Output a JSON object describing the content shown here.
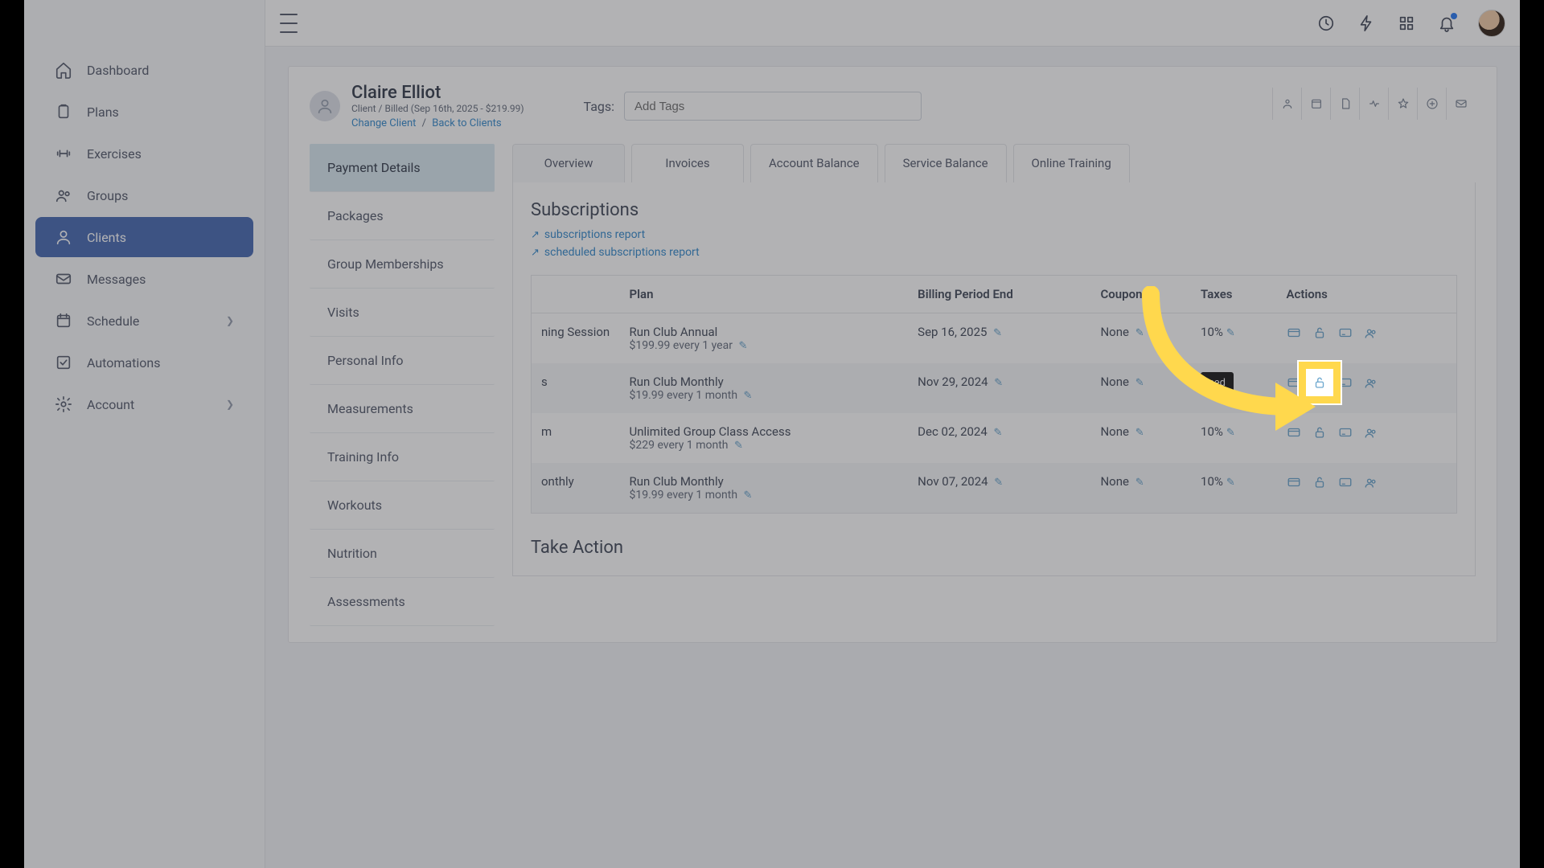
{
  "sidebar": {
    "items": [
      {
        "label": "Dashboard"
      },
      {
        "label": "Plans"
      },
      {
        "label": "Exercises"
      },
      {
        "label": "Groups"
      },
      {
        "label": "Clients"
      },
      {
        "label": "Messages"
      },
      {
        "label": "Schedule"
      },
      {
        "label": "Automations"
      },
      {
        "label": "Account"
      }
    ]
  },
  "client": {
    "name": "Claire Elliot",
    "meta": "Client / Billed (Sep 16th, 2025 - $219.99)",
    "change": "Change Client",
    "back": "Back to Clients",
    "tags_label": "Tags:",
    "tags_placeholder": "Add Tags"
  },
  "lefttabs": [
    "Payment Details",
    "Packages",
    "Group Memberships",
    "Visits",
    "Personal Info",
    "Measurements",
    "Training Info",
    "Workouts",
    "Nutrition",
    "Assessments"
  ],
  "subtabs": [
    "Overview",
    "Invoices",
    "Account Balance",
    "Service Balance",
    "Online Training"
  ],
  "subs": {
    "title": "Subscriptions",
    "link1": "subscriptions report",
    "link2": "scheduled subscriptions report",
    "headers": {
      "col0": "",
      "plan": "Plan",
      "bpe": "Billing Period End",
      "coupon": "Coupon",
      "taxes": "Taxes",
      "actions": "Actions"
    },
    "rows": [
      {
        "left": "ning Session",
        "plan": "Run Club Annual",
        "price": "$199.99 every 1 year",
        "bpe": "Sep 16, 2025",
        "coupon": "None",
        "tax": "10%",
        "highlight": false,
        "tipMasked": false
      },
      {
        "left": "s",
        "plan": "Run Club Monthly",
        "price": "$19.99 every 1 month",
        "bpe": "Nov 29, 2024",
        "coupon": "None",
        "tax": "",
        "highlight": true,
        "tipMasked": true,
        "tipText": "sed"
      },
      {
        "left": "m",
        "plan": "Unlimited Group Class Access",
        "price": "$229 every 1 month",
        "bpe": "Dec 02, 2024",
        "coupon": "None",
        "tax": "10%",
        "highlight": false,
        "tipMasked": false
      },
      {
        "left": "onthly",
        "plan": "Run Club Monthly",
        "price": "$19.99 every 1 month",
        "bpe": "Nov 07, 2024",
        "coupon": "None",
        "tax": "10%",
        "highlight": false,
        "tipMasked": false
      }
    ]
  },
  "take_action": "Take Action",
  "colors": {
    "accent": "#4e6fb5",
    "link": "#3d8fcf",
    "highlight": "#ffd84d"
  }
}
